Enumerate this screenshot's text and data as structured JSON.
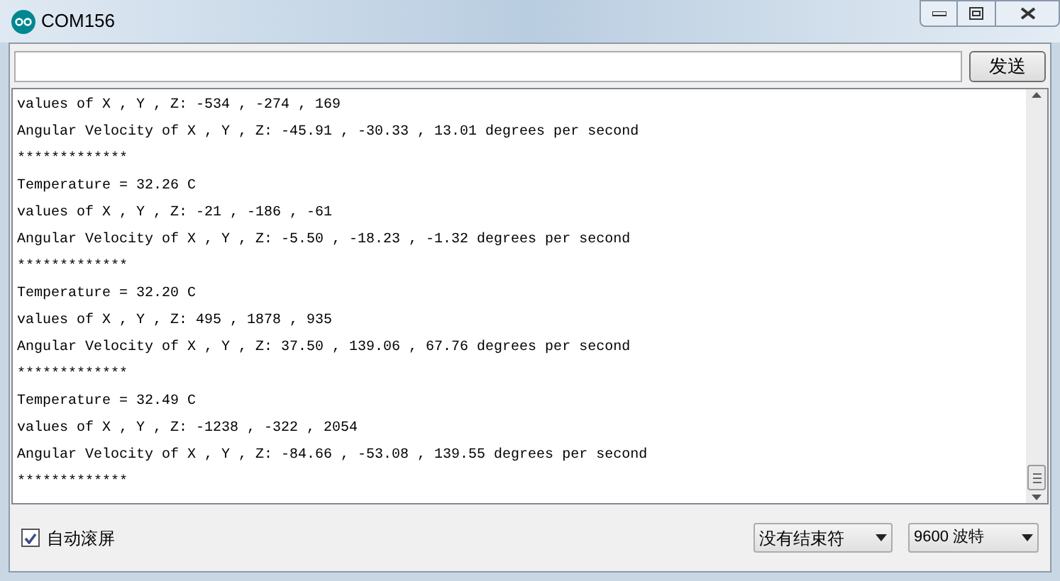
{
  "window": {
    "title": "COM156"
  },
  "send": {
    "button": "发送"
  },
  "output": {
    "lines": [
      "values of X , Y , Z: -534 , -274 , 169",
      "Angular Velocity of X , Y , Z: -45.91 , -30.33 , 13.01 degrees per second",
      "*************",
      "Temperature = 32.26 C",
      "values of X , Y , Z: -21 , -186 , -61",
      "Angular Velocity of X , Y , Z: -5.50 , -18.23 , -1.32 degrees per second",
      "*************",
      "Temperature = 32.20 C",
      "values of X , Y , Z: 495 , 1878 , 935",
      "Angular Velocity of X , Y , Z: 37.50 , 139.06 , 67.76 degrees per second",
      "*************",
      "Temperature = 32.49 C",
      "values of X , Y , Z: -1238 , -322 , 2054",
      "Angular Velocity of X , Y , Z: -84.66 , -53.08 , 139.55 degrees per second",
      "*************"
    ]
  },
  "footer": {
    "autoscroll": {
      "label": "自动滚屏",
      "checked": true
    },
    "line_ending": "没有结束符",
    "baud": "9600 波特"
  }
}
